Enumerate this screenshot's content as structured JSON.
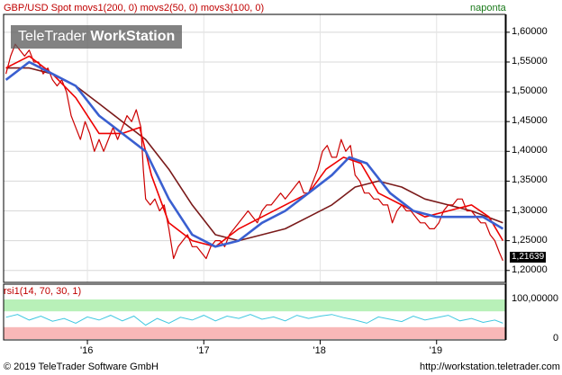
{
  "header": {
    "title": "GBP/USD Spot movs1(200, 0) movs2(50, 0) movs3(100, 0)",
    "period": "naponta"
  },
  "watermark": {
    "brand": "TeleTrader",
    "product": "WorkStation"
  },
  "last_price": "1,21639",
  "rsi_header": "rsi1(14, 70, 30, 1)",
  "footer": {
    "copyright": "© 2019 TeleTrader Software GmbH",
    "url": "http://workstation.teletrader.com"
  },
  "colors": {
    "price": "#cc0000",
    "movs1": "#7a1a1a",
    "movs2": "#ee0000",
    "movs3": "#3a5fd0",
    "rsi": "#40c8e0",
    "rsi_upper_band": "#b8f0b8",
    "rsi_lower_band": "#f8b8b8"
  },
  "chart_data": [
    {
      "type": "line",
      "ylim": [
        1.18,
        1.63
      ],
      "yticks": [
        1.2,
        1.25,
        1.3,
        1.35,
        1.4,
        1.45,
        1.5,
        1.55,
        1.6
      ],
      "ytick_labels": [
        "1,20000",
        "1,25000",
        "1,30000",
        "1,35000",
        "1,40000",
        "1,45000",
        "1,50000",
        "1,55000",
        "1,60000"
      ],
      "x_labels": [
        {
          "label": "'16",
          "x": 2016.0
        },
        {
          "label": "'17",
          "x": 2017.0
        },
        {
          "label": "'18",
          "x": 2018.0
        },
        {
          "label": "'19",
          "x": 2019.0
        }
      ],
      "xlim": [
        2015.28,
        2019.59
      ],
      "series": [
        {
          "key": "price",
          "x": [
            2015.3,
            2015.34,
            2015.38,
            2015.42,
            2015.46,
            2015.5,
            2015.54,
            2015.58,
            2015.62,
            2015.66,
            2015.7,
            2015.74,
            2015.78,
            2015.82,
            2015.86,
            2015.9,
            2015.94,
            2015.98,
            2016.02,
            2016.06,
            2016.1,
            2016.14,
            2016.18,
            2016.22,
            2016.26,
            2016.3,
            2016.34,
            2016.38,
            2016.42,
            2016.46,
            2016.48,
            2016.5,
            2016.54,
            2016.58,
            2016.62,
            2016.66,
            2016.7,
            2016.74,
            2016.78,
            2016.82,
            2016.86,
            2016.9,
            2016.94,
            2016.98,
            2017.02,
            2017.06,
            2017.1,
            2017.14,
            2017.18,
            2017.22,
            2017.26,
            2017.3,
            2017.34,
            2017.38,
            2017.42,
            2017.46,
            2017.5,
            2017.54,
            2017.58,
            2017.62,
            2017.66,
            2017.7,
            2017.74,
            2017.78,
            2017.82,
            2017.86,
            2017.9,
            2017.94,
            2017.98,
            2018.02,
            2018.06,
            2018.1,
            2018.14,
            2018.18,
            2018.22,
            2018.26,
            2018.3,
            2018.34,
            2018.38,
            2018.42,
            2018.46,
            2018.5,
            2018.54,
            2018.58,
            2018.62,
            2018.66,
            2018.7,
            2018.74,
            2018.78,
            2018.82,
            2018.86,
            2018.9,
            2018.94,
            2018.98,
            2019.02,
            2019.06,
            2019.1,
            2019.14,
            2019.18,
            2019.22,
            2019.26,
            2019.3,
            2019.34,
            2019.38,
            2019.42,
            2019.46,
            2019.5,
            2019.54,
            2019.57
          ],
          "y": [
            1.53,
            1.56,
            1.58,
            1.57,
            1.56,
            1.57,
            1.55,
            1.55,
            1.53,
            1.54,
            1.52,
            1.51,
            1.52,
            1.5,
            1.46,
            1.44,
            1.42,
            1.45,
            1.43,
            1.4,
            1.42,
            1.4,
            1.42,
            1.44,
            1.42,
            1.44,
            1.46,
            1.45,
            1.47,
            1.44,
            1.37,
            1.32,
            1.31,
            1.32,
            1.3,
            1.31,
            1.27,
            1.22,
            1.24,
            1.25,
            1.26,
            1.24,
            1.24,
            1.23,
            1.22,
            1.24,
            1.25,
            1.25,
            1.24,
            1.26,
            1.27,
            1.28,
            1.29,
            1.3,
            1.29,
            1.28,
            1.3,
            1.31,
            1.31,
            1.32,
            1.33,
            1.32,
            1.33,
            1.34,
            1.35,
            1.33,
            1.33,
            1.35,
            1.37,
            1.4,
            1.41,
            1.39,
            1.39,
            1.42,
            1.4,
            1.41,
            1.36,
            1.35,
            1.33,
            1.33,
            1.32,
            1.32,
            1.31,
            1.31,
            1.28,
            1.3,
            1.31,
            1.3,
            1.3,
            1.29,
            1.28,
            1.28,
            1.27,
            1.27,
            1.28,
            1.3,
            1.31,
            1.31,
            1.32,
            1.32,
            1.3,
            1.3,
            1.29,
            1.28,
            1.28,
            1.26,
            1.25,
            1.23,
            1.21639
          ]
        },
        {
          "key": "movs1",
          "x": [
            2015.3,
            2015.5,
            2015.7,
            2015.9,
            2016.1,
            2016.3,
            2016.5,
            2016.7,
            2016.9,
            2017.1,
            2017.3,
            2017.5,
            2017.7,
            2017.9,
            2018.1,
            2018.3,
            2018.5,
            2018.7,
            2018.9,
            2019.1,
            2019.3,
            2019.57
          ],
          "y": [
            1.54,
            1.54,
            1.53,
            1.51,
            1.48,
            1.45,
            1.42,
            1.37,
            1.31,
            1.26,
            1.25,
            1.26,
            1.27,
            1.29,
            1.31,
            1.34,
            1.35,
            1.34,
            1.32,
            1.31,
            1.3,
            1.28
          ]
        },
        {
          "key": "movs2",
          "x": [
            2015.3,
            2015.5,
            2015.7,
            2015.9,
            2016.1,
            2016.3,
            2016.45,
            2016.55,
            2016.7,
            2016.9,
            2017.1,
            2017.3,
            2017.5,
            2017.7,
            2017.9,
            2018.05,
            2018.2,
            2018.35,
            2018.5,
            2018.7,
            2018.9,
            2019.1,
            2019.3,
            2019.45,
            2019.57
          ],
          "y": [
            1.54,
            1.56,
            1.53,
            1.49,
            1.43,
            1.43,
            1.44,
            1.36,
            1.28,
            1.25,
            1.24,
            1.27,
            1.29,
            1.31,
            1.33,
            1.37,
            1.39,
            1.38,
            1.33,
            1.31,
            1.29,
            1.3,
            1.31,
            1.29,
            1.25
          ]
        },
        {
          "key": "movs3",
          "x": [
            2015.3,
            2015.5,
            2015.7,
            2015.9,
            2016.1,
            2016.3,
            2016.5,
            2016.7,
            2016.9,
            2017.1,
            2017.3,
            2017.5,
            2017.7,
            2017.9,
            2018.1,
            2018.25,
            2018.4,
            2018.6,
            2018.8,
            2019.0,
            2019.2,
            2019.4,
            2019.57
          ],
          "y": [
            1.52,
            1.55,
            1.53,
            1.51,
            1.46,
            1.43,
            1.4,
            1.32,
            1.26,
            1.24,
            1.25,
            1.28,
            1.3,
            1.33,
            1.36,
            1.39,
            1.38,
            1.33,
            1.3,
            1.29,
            1.29,
            1.29,
            1.27
          ]
        }
      ]
    },
    {
      "type": "line",
      "ylim": [
        0,
        100
      ],
      "yticks": [
        0,
        100
      ],
      "ytick_labels": [
        "0",
        "100,00000"
      ],
      "bands": [
        [
          0,
          30
        ],
        [
          70,
          100
        ]
      ],
      "series": [
        {
          "key": "rsi",
          "x": [
            2015.3,
            2015.4,
            2015.5,
            2015.6,
            2015.7,
            2015.8,
            2015.9,
            2016.0,
            2016.1,
            2016.2,
            2016.3,
            2016.4,
            2016.5,
            2016.6,
            2016.7,
            2016.8,
            2016.9,
            2017.0,
            2017.1,
            2017.2,
            2017.3,
            2017.4,
            2017.5,
            2017.6,
            2017.7,
            2017.8,
            2017.9,
            2018.0,
            2018.1,
            2018.2,
            2018.3,
            2018.4,
            2018.5,
            2018.6,
            2018.7,
            2018.8,
            2018.9,
            2019.0,
            2019.1,
            2019.2,
            2019.3,
            2019.4,
            2019.5,
            2019.57
          ],
          "y": [
            55,
            62,
            48,
            58,
            45,
            52,
            40,
            56,
            48,
            60,
            46,
            58,
            35,
            52,
            40,
            55,
            48,
            60,
            46,
            58,
            52,
            62,
            50,
            56,
            46,
            60,
            52,
            58,
            62,
            54,
            48,
            40,
            56,
            50,
            44,
            58,
            48,
            54,
            60,
            46,
            52,
            42,
            48,
            40
          ]
        }
      ]
    }
  ]
}
